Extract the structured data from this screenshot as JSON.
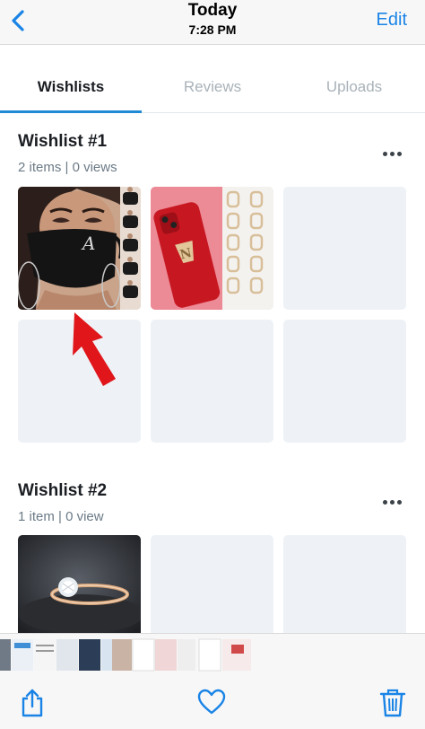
{
  "nav": {
    "title": "Today",
    "time": "7:28 PM",
    "edit_label": "Edit",
    "back_icon": "chevron-left-icon",
    "accent": "#1a84e6"
  },
  "tabs": [
    {
      "label": "Wishlists",
      "active": true
    },
    {
      "label": "Reviews",
      "active": false
    },
    {
      "label": "Uploads",
      "active": false
    }
  ],
  "wishlists": [
    {
      "title": "Wishlist #1",
      "meta": "2 items | 0 views",
      "items": [
        "face-mask-product-photo",
        "phone-case-and-letter-charms-photo"
      ]
    },
    {
      "title": "Wishlist #2",
      "meta": "1 item | 0 view",
      "items": [
        "diamond-ring-photo"
      ]
    }
  ],
  "annotation": {
    "type": "arrow",
    "color": "#e0161b"
  },
  "toolbar": {
    "share_icon": "share-icon",
    "favorite_icon": "heart-icon",
    "delete_icon": "trash-icon"
  }
}
